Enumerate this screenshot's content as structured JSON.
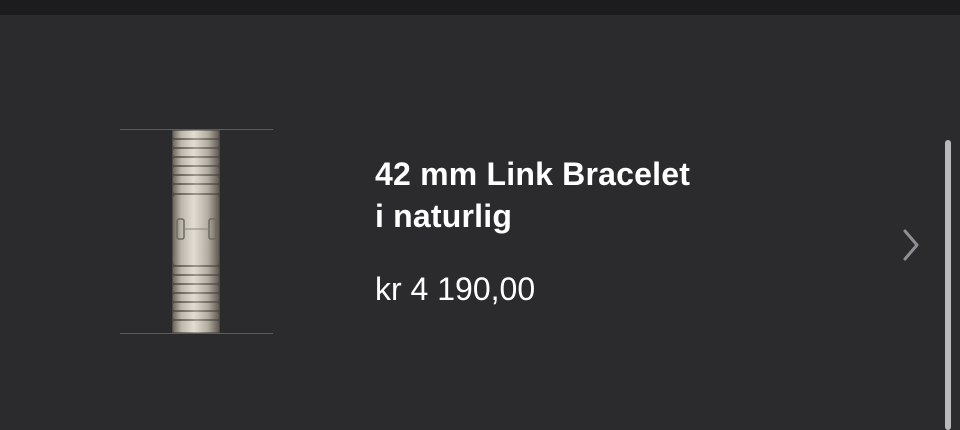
{
  "product": {
    "image_alt": "Link Bracelet",
    "title_line1": "42 mm Link Bracelet",
    "title_line2": "i naturlig",
    "price": "kr 4 190,00"
  },
  "icons": {
    "chevron": "chevron-right-icon"
  },
  "colors": {
    "background": "#2b2b2e",
    "top_bar": "#1c1c1e",
    "text": "#ffffff",
    "chevron": "#8e8e93",
    "scrollbar": "#b9b9bb"
  }
}
